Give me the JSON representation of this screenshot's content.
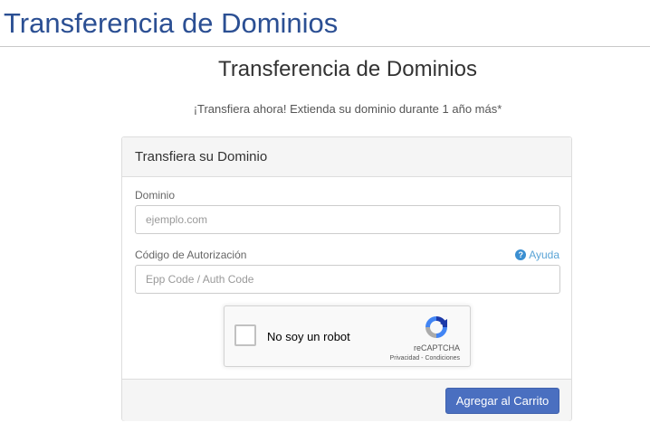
{
  "header": {
    "title": "Transferencia de Dominios"
  },
  "main": {
    "title": "Transferencia de Dominios",
    "subtitle": "¡Transfiera ahora! Extienda su dominio durante 1 año más*"
  },
  "panel": {
    "heading": "Transfiera su Dominio",
    "domain": {
      "label": "Dominio",
      "value": "",
      "placeholder": "ejemplo.com"
    },
    "auth": {
      "label": "Código de Autorización",
      "value": "",
      "placeholder": "Epp Code / Auth Code"
    },
    "help": {
      "icon": "question-circle-icon",
      "label": "Ayuda"
    },
    "captcha": {
      "label": "No soy un robot",
      "brand": "reCAPTCHA",
      "privacy": "Privacidad",
      "separator": " - ",
      "terms": "Condiciones",
      "icon": "recaptcha-logo-icon"
    },
    "submit_label": "Agregar al Carrito"
  },
  "colors": {
    "header_title": "#2b4f93",
    "button_bg": "#4a6fc0",
    "help_link": "#5aa4d6",
    "panel_bg": "#f5f5f5"
  }
}
